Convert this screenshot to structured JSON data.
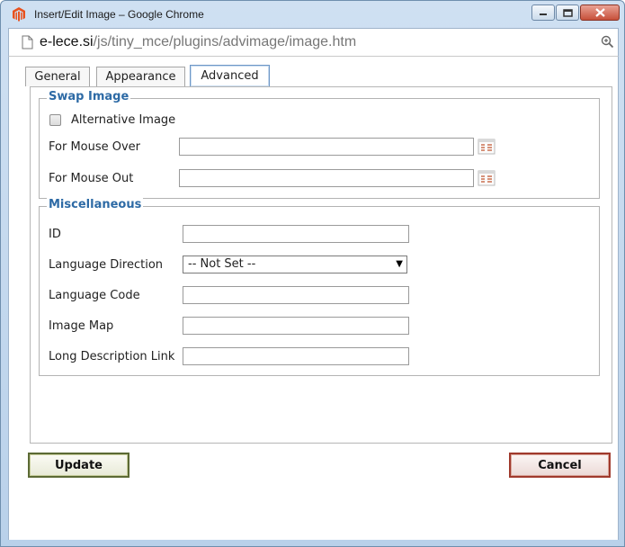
{
  "window": {
    "title": "Insert/Edit Image – Google Chrome",
    "url_host": "e-lece.si",
    "url_path": "/js/tiny_mce/plugins/advimage/image.htm",
    "icons": {
      "app": "magento-icon",
      "page": "page-icon",
      "zoom": "zoom-icon"
    }
  },
  "tabs": [
    {
      "label": "General",
      "active": false
    },
    {
      "label": "Appearance",
      "active": false
    },
    {
      "label": "Advanced",
      "active": true
    }
  ],
  "swap_image": {
    "legend": "Swap Image",
    "alternative_image_label": "Alternative Image",
    "alternative_image_checked": false,
    "mouse_over_label": "For Mouse Over",
    "mouse_over_value": "",
    "mouse_out_label": "For Mouse Out",
    "mouse_out_value": ""
  },
  "misc": {
    "legend": "Miscellaneous",
    "id_label": "ID",
    "id_value": "",
    "lang_dir_label": "Language Direction",
    "lang_dir_value": "-- Not Set --",
    "lang_code_label": "Language Code",
    "lang_code_value": "",
    "image_map_label": "Image Map",
    "image_map_value": "",
    "long_desc_label": "Long Description Link",
    "long_desc_value": ""
  },
  "buttons": {
    "update": "Update",
    "cancel": "Cancel"
  },
  "colors": {
    "legend": "#2d6aa5",
    "update_border": "#5c6a35",
    "cancel_border": "#a03a2d"
  }
}
